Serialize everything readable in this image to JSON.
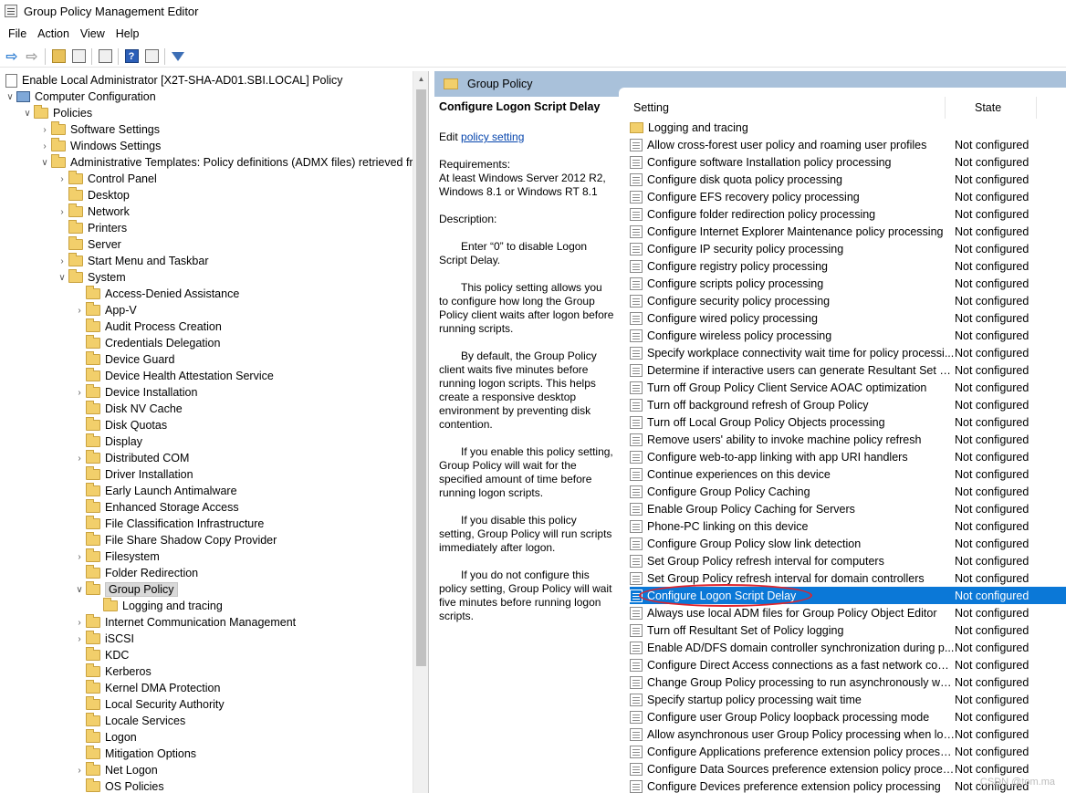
{
  "window": {
    "title": "Group Policy Management Editor"
  },
  "menubar": [
    "File",
    "Action",
    "View",
    "Help"
  ],
  "toolbar": {
    "buttons": [
      "back-icon",
      "forward-icon",
      "up-folder-icon",
      "show-hide-tree-icon",
      "export-list-icon",
      "help-icon",
      "properties-icon",
      "filter-icon"
    ]
  },
  "tree": [
    {
      "label": "Enable Local Administrator [X2T-SHA-AD01.SBI.LOCAL] Policy",
      "level": 0,
      "icon": "doc",
      "exp": ""
    },
    {
      "label": "Computer Configuration",
      "level": 0,
      "icon": "computer",
      "exp": "open"
    },
    {
      "label": "Policies",
      "level": 1,
      "icon": "folder",
      "exp": "open"
    },
    {
      "label": "Software Settings",
      "level": 2,
      "icon": "folder",
      "exp": "closed"
    },
    {
      "label": "Windows Settings",
      "level": 2,
      "icon": "folder",
      "exp": "closed"
    },
    {
      "label": "Administrative Templates: Policy definitions (ADMX files) retrieved from",
      "level": 2,
      "icon": "folder",
      "exp": "open"
    },
    {
      "label": "Control Panel",
      "level": 3,
      "icon": "folder",
      "exp": "closed"
    },
    {
      "label": "Desktop",
      "level": 3,
      "icon": "folder",
      "exp": ""
    },
    {
      "label": "Network",
      "level": 3,
      "icon": "folder",
      "exp": "closed"
    },
    {
      "label": "Printers",
      "level": 3,
      "icon": "folder",
      "exp": ""
    },
    {
      "label": "Server",
      "level": 3,
      "icon": "folder",
      "exp": ""
    },
    {
      "label": "Start Menu and Taskbar",
      "level": 3,
      "icon": "folder",
      "exp": "closed"
    },
    {
      "label": "System",
      "level": 3,
      "icon": "folder",
      "exp": "open"
    },
    {
      "label": "Access-Denied Assistance",
      "level": 4,
      "icon": "folder",
      "exp": ""
    },
    {
      "label": "App-V",
      "level": 4,
      "icon": "folder",
      "exp": "closed"
    },
    {
      "label": "Audit Process Creation",
      "level": 4,
      "icon": "folder",
      "exp": ""
    },
    {
      "label": "Credentials Delegation",
      "level": 4,
      "icon": "folder",
      "exp": ""
    },
    {
      "label": "Device Guard",
      "level": 4,
      "icon": "folder",
      "exp": ""
    },
    {
      "label": "Device Health Attestation Service",
      "level": 4,
      "icon": "folder",
      "exp": ""
    },
    {
      "label": "Device Installation",
      "level": 4,
      "icon": "folder",
      "exp": "closed"
    },
    {
      "label": "Disk NV Cache",
      "level": 4,
      "icon": "folder",
      "exp": ""
    },
    {
      "label": "Disk Quotas",
      "level": 4,
      "icon": "folder",
      "exp": ""
    },
    {
      "label": "Display",
      "level": 4,
      "icon": "folder",
      "exp": ""
    },
    {
      "label": "Distributed COM",
      "level": 4,
      "icon": "folder",
      "exp": "closed"
    },
    {
      "label": "Driver Installation",
      "level": 4,
      "icon": "folder",
      "exp": ""
    },
    {
      "label": "Early Launch Antimalware",
      "level": 4,
      "icon": "folder",
      "exp": ""
    },
    {
      "label": "Enhanced Storage Access",
      "level": 4,
      "icon": "folder",
      "exp": ""
    },
    {
      "label": "File Classification Infrastructure",
      "level": 4,
      "icon": "folder",
      "exp": ""
    },
    {
      "label": "File Share Shadow Copy Provider",
      "level": 4,
      "icon": "folder",
      "exp": ""
    },
    {
      "label": "Filesystem",
      "level": 4,
      "icon": "folder",
      "exp": "closed"
    },
    {
      "label": "Folder Redirection",
      "level": 4,
      "icon": "folder",
      "exp": ""
    },
    {
      "label": "Group Policy",
      "level": 4,
      "icon": "folder",
      "exp": "open",
      "selected": true
    },
    {
      "label": "Logging and tracing",
      "level": 5,
      "icon": "folder",
      "exp": ""
    },
    {
      "label": "Internet Communication Management",
      "level": 4,
      "icon": "folder",
      "exp": "closed"
    },
    {
      "label": "iSCSI",
      "level": 4,
      "icon": "folder",
      "exp": "closed"
    },
    {
      "label": "KDC",
      "level": 4,
      "icon": "folder",
      "exp": ""
    },
    {
      "label": "Kerberos",
      "level": 4,
      "icon": "folder",
      "exp": ""
    },
    {
      "label": "Kernel DMA Protection",
      "level": 4,
      "icon": "folder",
      "exp": ""
    },
    {
      "label": "Local Security Authority",
      "level": 4,
      "icon": "folder",
      "exp": ""
    },
    {
      "label": "Locale Services",
      "level": 4,
      "icon": "folder",
      "exp": ""
    },
    {
      "label": "Logon",
      "level": 4,
      "icon": "folder",
      "exp": ""
    },
    {
      "label": "Mitigation Options",
      "level": 4,
      "icon": "folder",
      "exp": ""
    },
    {
      "label": "Net Logon",
      "level": 4,
      "icon": "folder",
      "exp": "closed"
    },
    {
      "label": "OS Policies",
      "level": 4,
      "icon": "folder",
      "exp": ""
    }
  ],
  "right": {
    "header": "Group Policy",
    "description": {
      "title": "Configure Logon Script Delay",
      "edit_prefix": "Edit ",
      "edit_link": "policy setting",
      "requirements_label": "Requirements:",
      "requirements_text": "At least Windows Server 2012 R2, Windows 8.1 or Windows RT 8.1",
      "description_label": "Description:",
      "paragraphs": [
        "Enter “0” to disable Logon Script Delay.",
        "This policy setting allows you to configure how long the Group Policy client waits after logon before running scripts.",
        "By default, the Group Policy client waits five minutes before running logon scripts. This helps create a responsive desktop environment by preventing disk contention.",
        "If you enable this policy setting, Group Policy will wait for the specified amount of time before running logon scripts.",
        "If you disable this policy setting, Group Policy will run scripts immediately after logon.",
        "If you do not configure this policy setting, Group Policy will wait five minutes before running logon scripts."
      ]
    },
    "columns": {
      "setting": "Setting",
      "state": "State"
    },
    "rows": [
      {
        "name": "Logging and tracing",
        "state": "",
        "folder": true
      },
      {
        "name": "Allow cross-forest user policy and roaming user profiles",
        "state": "Not configured"
      },
      {
        "name": "Configure software Installation policy processing",
        "state": "Not configured"
      },
      {
        "name": "Configure disk quota policy processing",
        "state": "Not configured"
      },
      {
        "name": "Configure EFS recovery policy processing",
        "state": "Not configured"
      },
      {
        "name": "Configure folder redirection policy processing",
        "state": "Not configured"
      },
      {
        "name": "Configure Internet Explorer Maintenance policy processing",
        "state": "Not configured"
      },
      {
        "name": "Configure IP security policy processing",
        "state": "Not configured"
      },
      {
        "name": "Configure registry policy processing",
        "state": "Not configured"
      },
      {
        "name": "Configure scripts policy processing",
        "state": "Not configured"
      },
      {
        "name": "Configure security policy processing",
        "state": "Not configured"
      },
      {
        "name": "Configure wired policy processing",
        "state": "Not configured"
      },
      {
        "name": "Configure wireless policy processing",
        "state": "Not configured"
      },
      {
        "name": "Specify workplace connectivity wait time for policy processi...",
        "state": "Not configured"
      },
      {
        "name": "Determine if interactive users can generate Resultant Set of ...",
        "state": "Not configured"
      },
      {
        "name": "Turn off Group Policy Client Service AOAC optimization",
        "state": "Not configured"
      },
      {
        "name": "Turn off background refresh of Group Policy",
        "state": "Not configured"
      },
      {
        "name": "Turn off Local Group Policy Objects processing",
        "state": "Not configured"
      },
      {
        "name": "Remove users' ability to invoke machine policy refresh",
        "state": "Not configured"
      },
      {
        "name": "Configure web-to-app linking with app URI handlers",
        "state": "Not configured"
      },
      {
        "name": "Continue experiences on this device",
        "state": "Not configured"
      },
      {
        "name": "Configure Group Policy Caching",
        "state": "Not configured"
      },
      {
        "name": "Enable Group Policy Caching for Servers",
        "state": "Not configured"
      },
      {
        "name": "Phone-PC linking on this device",
        "state": "Not configured"
      },
      {
        "name": "Configure Group Policy slow link detection",
        "state": "Not configured"
      },
      {
        "name": "Set Group Policy refresh interval for computers",
        "state": "Not configured"
      },
      {
        "name": "Set Group Policy refresh interval for domain controllers",
        "state": "Not configured"
      },
      {
        "name": "Configure Logon Script Delay",
        "state": "Not configured",
        "selected": true
      },
      {
        "name": "Always use local ADM files for Group Policy Object Editor",
        "state": "Not configured"
      },
      {
        "name": "Turn off Resultant Set of Policy logging",
        "state": "Not configured"
      },
      {
        "name": "Enable AD/DFS domain controller synchronization during p...",
        "state": "Not configured"
      },
      {
        "name": "Configure Direct Access connections as a fast network conn...",
        "state": "Not configured"
      },
      {
        "name": "Change Group Policy processing to run asynchronously wh...",
        "state": "Not configured"
      },
      {
        "name": "Specify startup policy processing wait time",
        "state": "Not configured"
      },
      {
        "name": "Configure user Group Policy loopback processing mode",
        "state": "Not configured"
      },
      {
        "name": "Allow asynchronous user Group Policy processing when log...",
        "state": "Not configured"
      },
      {
        "name": "Configure Applications preference extension policy processi...",
        "state": "Not configured"
      },
      {
        "name": "Configure Data Sources preference extension policy processi...",
        "state": "Not configured"
      },
      {
        "name": "Configure Devices preference extension policy processing",
        "state": "Not configured"
      }
    ]
  },
  "watermark": "CSDN @tom.ma",
  "colors": {
    "selection": "#0b78d7",
    "header_band": "#a9c1da",
    "annotation": "#e0232a"
  }
}
